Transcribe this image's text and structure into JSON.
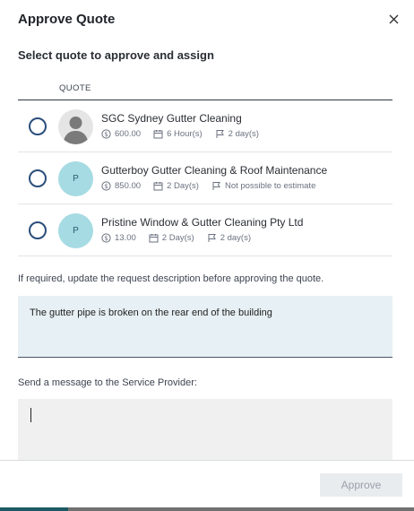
{
  "dialog": {
    "title": "Approve Quote",
    "close_icon": "close-icon"
  },
  "section_title": "Select quote to approve and assign",
  "columns": {
    "quote": "QUOTE"
  },
  "quotes": [
    {
      "name": "SGC Sydney Gutter Cleaning",
      "avatar_text": "",
      "price": "600.00",
      "duration": "6 Hour(s)",
      "availability": "2 day(s)",
      "selected": false
    },
    {
      "name": "Gutterboy Gutter Cleaning & Roof Maintenance",
      "avatar_text": "P",
      "price": "850.00",
      "duration": "2 Day(s)",
      "availability": "Not possible to estimate",
      "selected": false
    },
    {
      "name": "Pristine Window & Gutter Cleaning Pty Ltd",
      "avatar_text": "P",
      "price": "13.00",
      "duration": "2 Day(s)",
      "availability": "2 day(s)",
      "selected": false
    }
  ],
  "description": {
    "hint": "If required, update the request description before approving the quote.",
    "value": "The gutter pipe is broken on the rear end of the building"
  },
  "message": {
    "label": "Send a message to the Service Provider:",
    "value": ""
  },
  "footer": {
    "approve_label": "Approve",
    "approve_enabled": false
  },
  "colors": {
    "radio": "#2a4e7b",
    "avatar_bg": "#a6dbe3",
    "description_bg": "#e7f0f4",
    "message_bg": "#f0f0f0",
    "approve_disabled_bg": "#e9ecef"
  }
}
